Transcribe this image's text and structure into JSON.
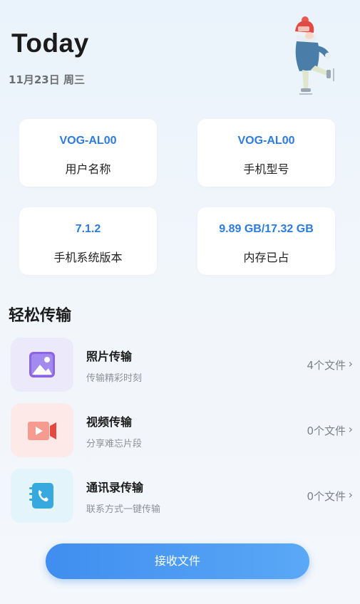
{
  "header": {
    "title": "Today",
    "date": "11月23日 周三"
  },
  "device_info": [
    {
      "value": "VOG-AL00",
      "label": "用户名称"
    },
    {
      "value": "VOG-AL00",
      "label": "手机型号"
    },
    {
      "value": "7.1.2",
      "label": "手机系统版本"
    },
    {
      "value": "9.89 GB/17.32 GB",
      "label": "内存已占"
    }
  ],
  "transfer": {
    "section_title": "轻松传输",
    "items": [
      {
        "title": "照片传输",
        "subtitle": "传输精彩时刻",
        "count": "4个文件",
        "icon": "photo-icon"
      },
      {
        "title": "视频传输",
        "subtitle": "分享难忘片段",
        "count": "0个文件",
        "icon": "video-icon"
      },
      {
        "title": "通讯录传输",
        "subtitle": "联系方式一键传输",
        "count": "0个文件",
        "icon": "contacts-icon"
      }
    ]
  },
  "actions": {
    "receive_label": "接收文件"
  },
  "colors": {
    "accent": "#2b7be0",
    "button": "#4a9af2"
  }
}
